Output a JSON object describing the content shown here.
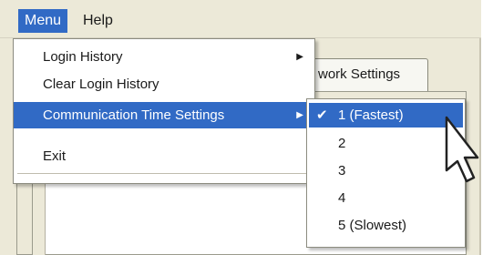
{
  "menubar": {
    "items": [
      {
        "label": "Menu"
      },
      {
        "label": "Help"
      }
    ]
  },
  "tab": {
    "label": "work Settings"
  },
  "menu": {
    "items": [
      {
        "label": "Login History",
        "has_submenu": true
      },
      {
        "label": "Clear Login History",
        "has_submenu": false
      },
      {
        "label": "Communication Time Settings",
        "has_submenu": true
      },
      {
        "label": "Exit",
        "has_submenu": false
      }
    ],
    "arrow_icon": "triangle-right-icon"
  },
  "submenu": {
    "items": [
      {
        "label": "1 (Fastest)",
        "checked": true
      },
      {
        "label": "2",
        "checked": false
      },
      {
        "label": "3",
        "checked": false
      },
      {
        "label": "4",
        "checked": false
      },
      {
        "label": "5 (Slowest)",
        "checked": false
      }
    ],
    "check_icon": "checkmark-icon"
  },
  "colors": {
    "highlight": "#316ac5",
    "window_bg": "#ece9d8",
    "menu_bg": "#ffffff"
  }
}
